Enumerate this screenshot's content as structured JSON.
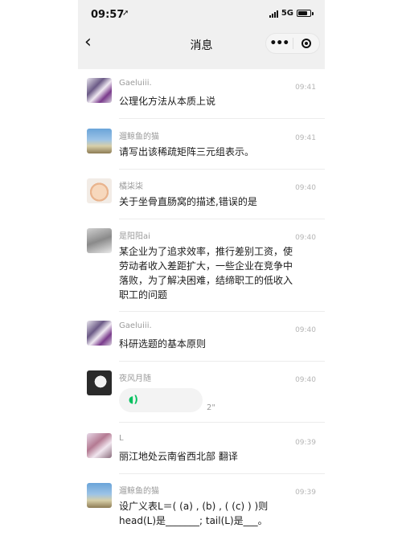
{
  "status_bar": {
    "time": "09:57",
    "location_arrow": "location-arrow",
    "network": "5G"
  },
  "nav": {
    "back": "‹",
    "title": "消息"
  },
  "capsule": {
    "more": "•••"
  },
  "voice_glyph": "◖)",
  "messages": [
    {
      "name": "Gaeluiii.",
      "time": "09:41",
      "text": "公理化方法从本质上说"
    },
    {
      "name": "遛鲸鱼的猫",
      "time": "09:41",
      "text": "请写出该稀疏矩阵三元组表示。"
    },
    {
      "name": "橘柒柒",
      "time": "09:40",
      "text": "关于坐骨直肠窝的描述,错误的是"
    },
    {
      "name": "是阳阳ai",
      "time": "09:40",
      "text": "某企业为了追求效率，推行差别工资，使劳动者收入差距扩大，一些企业在竞争中落败，为了解决困难，结缔职工的低收入职工的问题"
    },
    {
      "name": "Gaeluiii.",
      "time": "09:40",
      "text": "科研选题的基本原则"
    },
    {
      "name": "夜风月随",
      "time": "09:40",
      "voice_duration": "2\""
    },
    {
      "name": "L",
      "time": "09:39",
      "text": "丽江地处云南省西北部 翻译"
    },
    {
      "name": "遛鲸鱼的猫",
      "time": "09:39",
      "text": "设广义表L＝( (a) , (b) , ( (c) ) )则head(L)是_______; tail(L)是___。"
    }
  ]
}
